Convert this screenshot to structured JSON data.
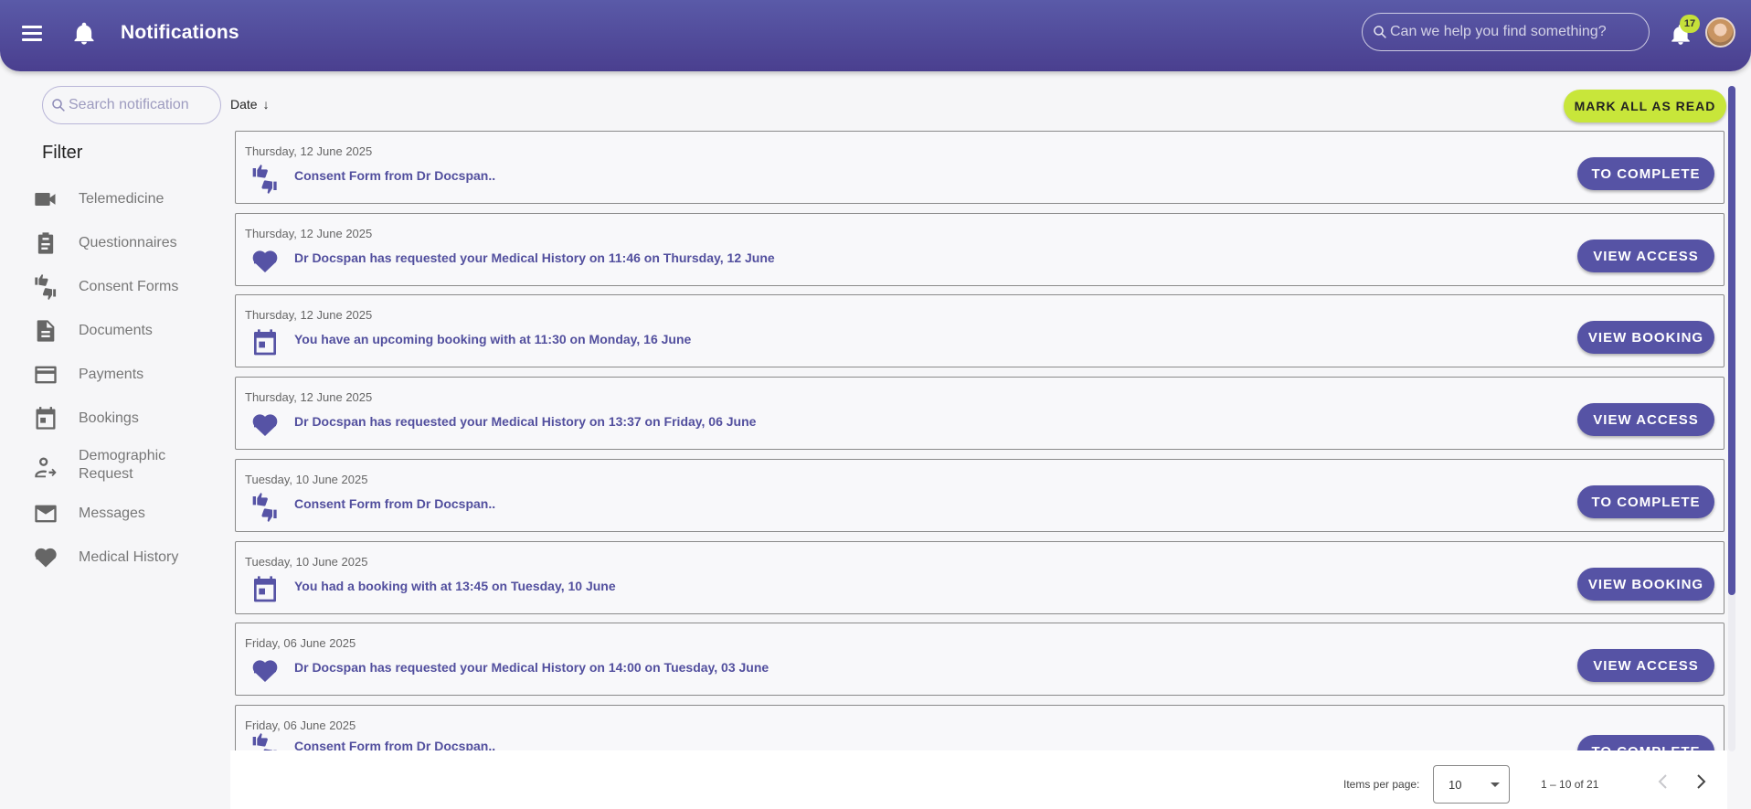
{
  "header": {
    "title": "Notifications",
    "search_placeholder": "Can we help you find something?",
    "notification_count": "17"
  },
  "sidebar": {
    "search_placeholder": "Search notification",
    "filter_title": "Filter",
    "items": [
      {
        "label": "Telemedicine",
        "icon": "video-camera-icon"
      },
      {
        "label": "Questionnaires",
        "icon": "clipboard-icon"
      },
      {
        "label": "Consent Forms",
        "icon": "thumbs-up-down-icon"
      },
      {
        "label": "Documents",
        "icon": "document-icon"
      },
      {
        "label": "Payments",
        "icon": "credit-card-icon"
      },
      {
        "label": "Bookings",
        "icon": "calendar-icon"
      },
      {
        "label": "Demographic Request",
        "icon": "person-arrow-icon"
      },
      {
        "label": "Messages",
        "icon": "envelope-icon"
      },
      {
        "label": "Medical History",
        "icon": "heart-pulse-icon"
      }
    ]
  },
  "toolbar": {
    "sort_label": "Date",
    "mark_all_label": "MARK ALL AS READ"
  },
  "notifications": [
    {
      "date": "Thursday, 12 June 2025",
      "icon": "thumbs-up-down-icon",
      "text": "Consent Form from Dr Docspan..",
      "action": "TO COMPLETE"
    },
    {
      "date": "Thursday, 12 June 2025",
      "icon": "heart-pulse-icon",
      "text": "Dr Docspan has requested your Medical History on 11:46 on Thursday, 12 June",
      "action": "VIEW ACCESS"
    },
    {
      "date": "Thursday, 12 June 2025",
      "icon": "calendar-icon",
      "text": "You have an upcoming booking with at 11:30 on Monday, 16 June",
      "action": "VIEW BOOKING"
    },
    {
      "date": "Thursday, 12 June 2025",
      "icon": "heart-pulse-icon",
      "text": "Dr Docspan has requested your Medical History on 13:37 on Friday, 06 June",
      "action": "VIEW ACCESS"
    },
    {
      "date": "Tuesday, 10 June 2025",
      "icon": "thumbs-up-down-icon",
      "text": "Consent Form from Dr Docspan..",
      "action": "TO COMPLETE"
    },
    {
      "date": "Tuesday, 10 June 2025",
      "icon": "calendar-icon",
      "text": "You had a booking with at 13:45 on Tuesday, 10 June",
      "action": "VIEW BOOKING"
    },
    {
      "date": "Friday, 06 June 2025",
      "icon": "heart-pulse-icon",
      "text": "Dr Docspan has requested your Medical History on 14:00 on Tuesday, 03 June",
      "action": "VIEW ACCESS"
    },
    {
      "date": "Friday, 06 June 2025",
      "icon": "thumbs-up-down-icon",
      "text": "Consent Form from Dr Docspan..",
      "action": "TO COMPLETE"
    }
  ],
  "paginator": {
    "items_per_page_label": "Items per page:",
    "items_per_page_value": "10",
    "range_label": "1 – 10 of 21"
  },
  "colors": {
    "primary": "#5653a5",
    "accent": "#c8e63a",
    "icon_gray": "#666666"
  }
}
